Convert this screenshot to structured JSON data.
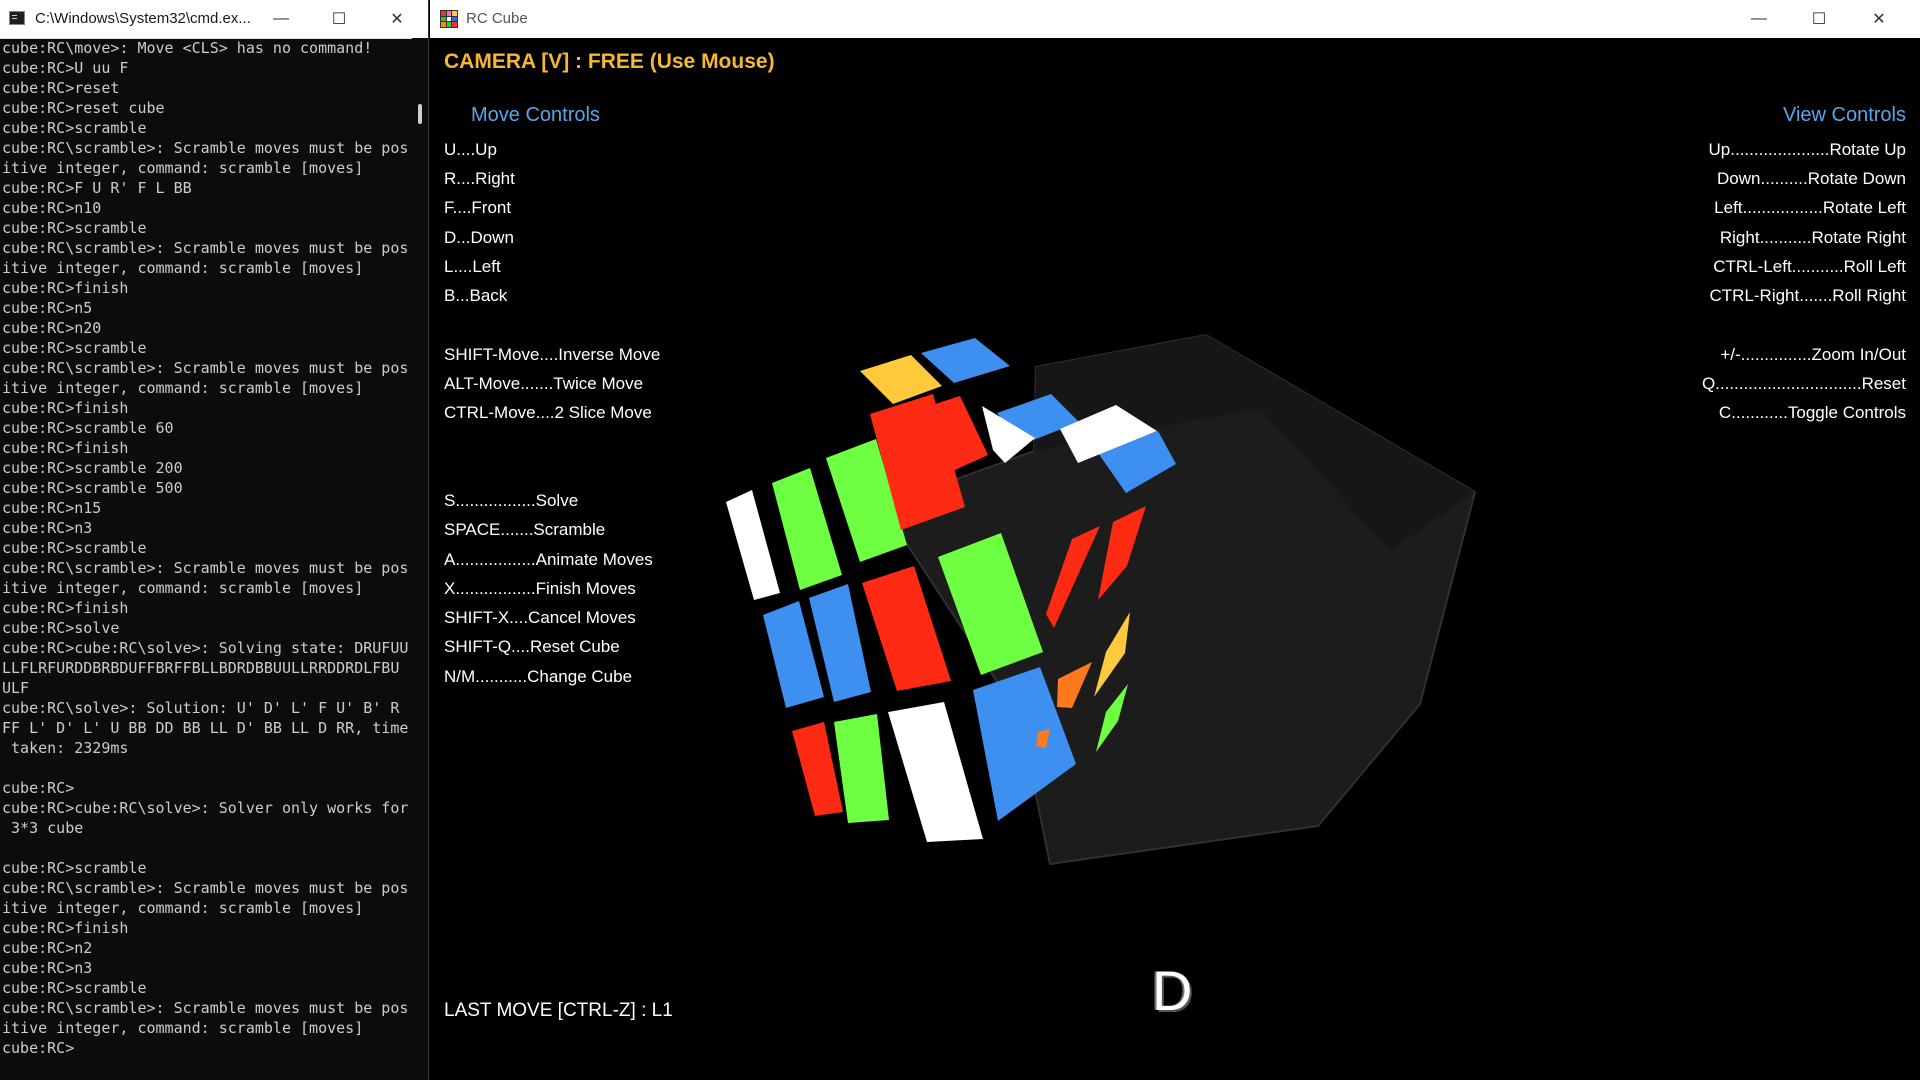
{
  "console_window": {
    "title": "C:\\Windows\\System32\\cmd.ex...",
    "buttons": {
      "minimize": "—",
      "maximize": "☐",
      "close": "✕"
    },
    "lines": [
      "cube:RC\\move>: Move <CLS> has no command!",
      "cube:RC>U uu F",
      "cube:RC>reset",
      "cube:RC>reset cube",
      "cube:RC>scramble",
      "cube:RC\\scramble>: Scramble moves must be pos",
      "itive integer, command: scramble [moves]",
      "cube:RC>F U R' F L BB",
      "cube:RC>n10",
      "cube:RC>scramble",
      "cube:RC\\scramble>: Scramble moves must be pos",
      "itive integer, command: scramble [moves]",
      "cube:RC>finish",
      "cube:RC>n5",
      "cube:RC>n20",
      "cube:RC>scramble",
      "cube:RC\\scramble>: Scramble moves must be pos",
      "itive integer, command: scramble [moves]",
      "cube:RC>finish",
      "cube:RC>scramble 60",
      "cube:RC>finish",
      "cube:RC>scramble 200",
      "cube:RC>scramble 500",
      "cube:RC>n15",
      "cube:RC>n3",
      "cube:RC>scramble",
      "cube:RC\\scramble>: Scramble moves must be pos",
      "itive integer, command: scramble [moves]",
      "cube:RC>finish",
      "cube:RC>solve",
      "cube:RC>cube:RC\\solve>: Solving state: DRUFUU",
      "LLFLRFURDDBRBDUFFBRFFBLLBDRDBBUULLRRDDRDLFBU",
      "ULF",
      "cube:RC\\solve>: Solution: U' D' L' F U' B' R",
      "FF L' D' L' U BB DD BB LL D' BB LL D RR, time",
      " taken: 2329ms",
      "",
      "cube:RC>",
      "cube:RC>cube:RC\\solve>: Solver only works for",
      " 3*3 cube",
      "",
      "cube:RC>scramble",
      "cube:RC\\scramble>: Scramble moves must be pos",
      "itive integer, command: scramble [moves]",
      "cube:RC>finish",
      "cube:RC>n2",
      "cube:RC>n3",
      "cube:RC>scramble",
      "cube:RC\\scramble>: Scramble moves must be pos",
      "itive integer, command: scramble [moves]",
      "cube:RC>"
    ]
  },
  "rc_window": {
    "title": "RC Cube",
    "buttons": {
      "minimize": "—",
      "maximize": "☐",
      "close": "✕"
    },
    "camera": "CAMERA [V] : FREE (Use Mouse)",
    "move_controls": {
      "title": "Move Controls",
      "items": [
        "U....Up",
        "R....Right",
        "F....Front",
        "D...Down",
        "L....Left",
        "B...Back"
      ]
    },
    "modifier_controls": [
      "SHIFT-Move....Inverse Move",
      "ALT-Move.......Twice Move",
      "CTRL-Move....2 Slice Move"
    ],
    "action_controls": [
      "S.................Solve",
      "SPACE.......Scramble",
      "A.................Animate Moves",
      "X.................Finish Moves",
      "SHIFT-X....Cancel Moves",
      "SHIFT-Q....Reset Cube",
      "N/M...........Change Cube"
    ],
    "view_controls": {
      "title": "View Controls",
      "items": [
        "Up.....................Rotate Up",
        "Down..........Rotate Down",
        "Left.................Rotate Left",
        "Right...........Rotate Right",
        "CTRL-Left...........Roll Left",
        "CTRL-Right.......Roll Right"
      ]
    },
    "view_extra": [
      "+/-...............Zoom In/Out",
      "Q...............................Reset",
      "C............Toggle Controls"
    ],
    "last_move": "LAST MOVE [CTRL-Z] : L1",
    "current_move": "D",
    "icon_colors": [
      "#e33",
      "#f6c",
      "#fc3",
      "#3b3",
      "#fff",
      "#36f",
      "#f80",
      "#3c3",
      "#e33"
    ],
    "cube_colors": {
      "red": "#ff2a14",
      "green": "#6fff42",
      "blue": "#3d8ff0",
      "white": "#ffffff",
      "yellow": "#ffc93c",
      "orange": "#ff7a1c",
      "body": "#1c1c1c"
    }
  }
}
